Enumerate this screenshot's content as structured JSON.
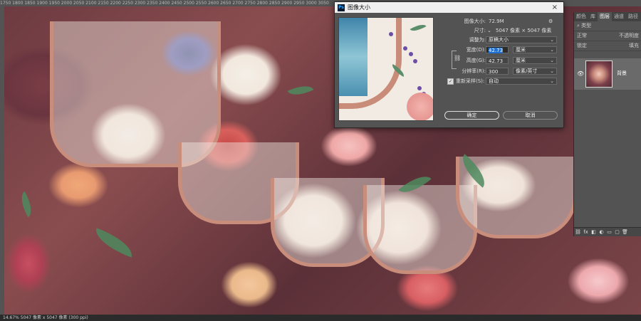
{
  "ruler_ticks": "1750  1800  1850  1900  1950  2000  2050  2100  2150  2200  2250  2300  2350  2400  2450  2500  2550  2600  2650  2700  2750  2800  2850  2900  2950  3000  3050",
  "status_text": "14.67%   5047 像素 x 5047 像素 (300 ppi)",
  "dialog": {
    "ps_logo": "Ps",
    "title": "图像大小",
    "close": "×",
    "image_size_label": "图像大小:",
    "image_size_value": "72.9M",
    "gear": "⚙",
    "dimensions_label": "尺寸:",
    "dimensions_value": "5047 像素 × 5047 像素",
    "fit_to_label": "调整为:",
    "fit_to_value": "原稿大小",
    "width_label": "宽度(D):",
    "width_value": "42.73",
    "width_unit": "厘米",
    "height_label": "高度(G):",
    "height_value": "42.73",
    "height_unit": "厘米",
    "resolution_label": "分辨率(R):",
    "resolution_value": "300",
    "resolution_unit": "像素/英寸",
    "resample_checked": true,
    "resample_label": "重新采样(S):",
    "resample_value": "自动",
    "ok_label": "确定",
    "cancel_label": "取消",
    "chevron": "⌄"
  },
  "panel": {
    "tabs": [
      "颜色",
      "库",
      "图层",
      "通道",
      "路径"
    ],
    "active_tab": "图层",
    "search_placeholder": "类型",
    "row2_label": "正常",
    "row2_right": "不透明度",
    "row3_label": "锁定",
    "row3_right": "填充",
    "layer_name": "背景",
    "bottom_icons": [
      "⛓",
      "fx",
      "◧",
      "◐",
      "▭",
      "▢",
      "🗑"
    ]
  }
}
